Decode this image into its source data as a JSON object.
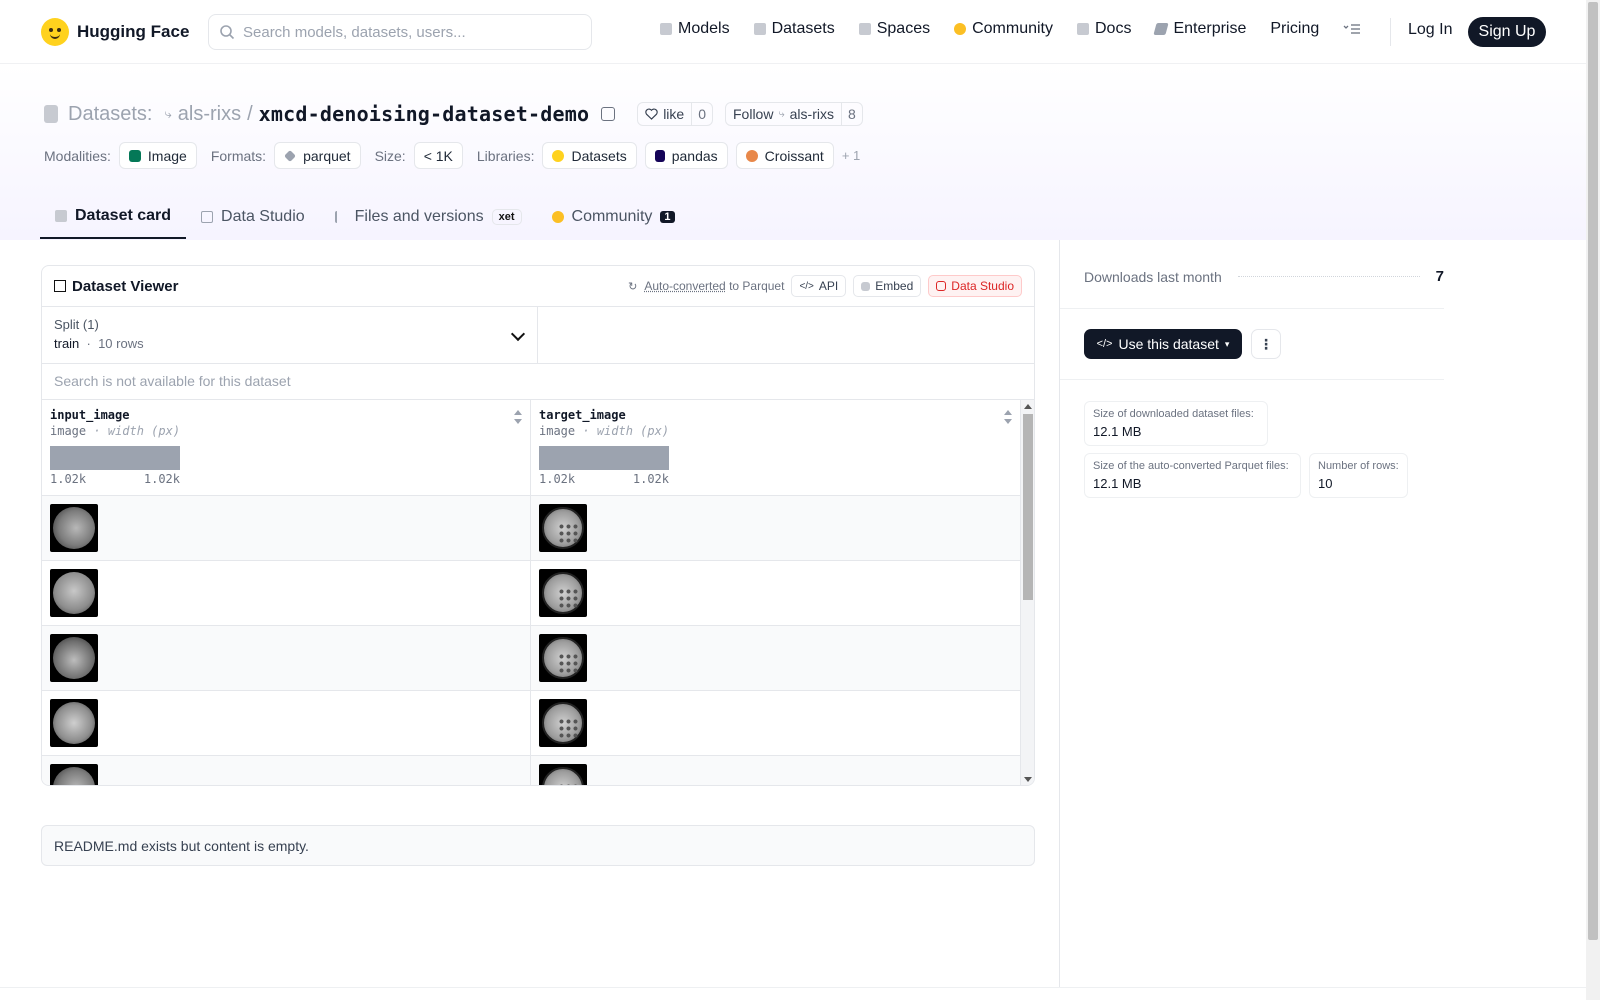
{
  "nav": {
    "brand": "Hugging Face",
    "search_placeholder": "Search models, datasets, users...",
    "links": [
      "Models",
      "Datasets",
      "Spaces",
      "Community",
      "Docs",
      "Enterprise",
      "Pricing"
    ],
    "login": "Log In",
    "signup": "Sign Up"
  },
  "repo": {
    "kind": "Datasets:",
    "owner": "als-rixs",
    "separator": "/",
    "name": "xmcd-denoising-dataset-demo",
    "like_label": "like",
    "like_count": "0",
    "follow_label": "Follow",
    "follow_org": "als-rixs",
    "follow_count": "8"
  },
  "meta": {
    "modalities_label": "Modalities:",
    "modality": "Image",
    "formats_label": "Formats:",
    "format": "parquet",
    "size_label": "Size:",
    "size": "< 1K",
    "libraries_label": "Libraries:",
    "libraries": [
      "Datasets",
      "pandas",
      "Croissant"
    ],
    "more": "+ 1"
  },
  "tabs": {
    "card": "Dataset card",
    "studio": "Data Studio",
    "files": "Files and versions",
    "xet": "xet",
    "community": "Community",
    "community_count": "1"
  },
  "viewer": {
    "title": "Dataset Viewer",
    "auto_converted": "Auto-converted",
    "to_parquet": "to Parquet",
    "api": "API",
    "embed": "Embed",
    "data_studio": "Data Studio",
    "split_label": "Split (1)",
    "split_name": "train",
    "split_rows": "10 rows",
    "search_na": "Search is not available for this dataset",
    "columns": [
      {
        "name": "input_image",
        "type": "image",
        "stat": "width (px)",
        "min": "1.02k",
        "max": "1.02k"
      },
      {
        "name": "target_image",
        "type": "image",
        "stat": "width (px)",
        "min": "1.02k",
        "max": "1.02k"
      }
    ]
  },
  "readme": "README.md exists but content is empty.",
  "sidebar": {
    "downloads_label": "Downloads last month",
    "downloads": "7",
    "use_button": "Use this dataset",
    "download_size_label": "Size of downloaded dataset files:",
    "download_size": "12.1 MB",
    "parquet_size_label": "Size of the auto-converted Parquet files:",
    "parquet_size": "12.1 MB",
    "rows_label": "Number of rows:",
    "rows": "10"
  },
  "colors": {
    "primary": "#111827",
    "accent_red": "#dc2626",
    "brand_yellow": "#ffd21e"
  }
}
